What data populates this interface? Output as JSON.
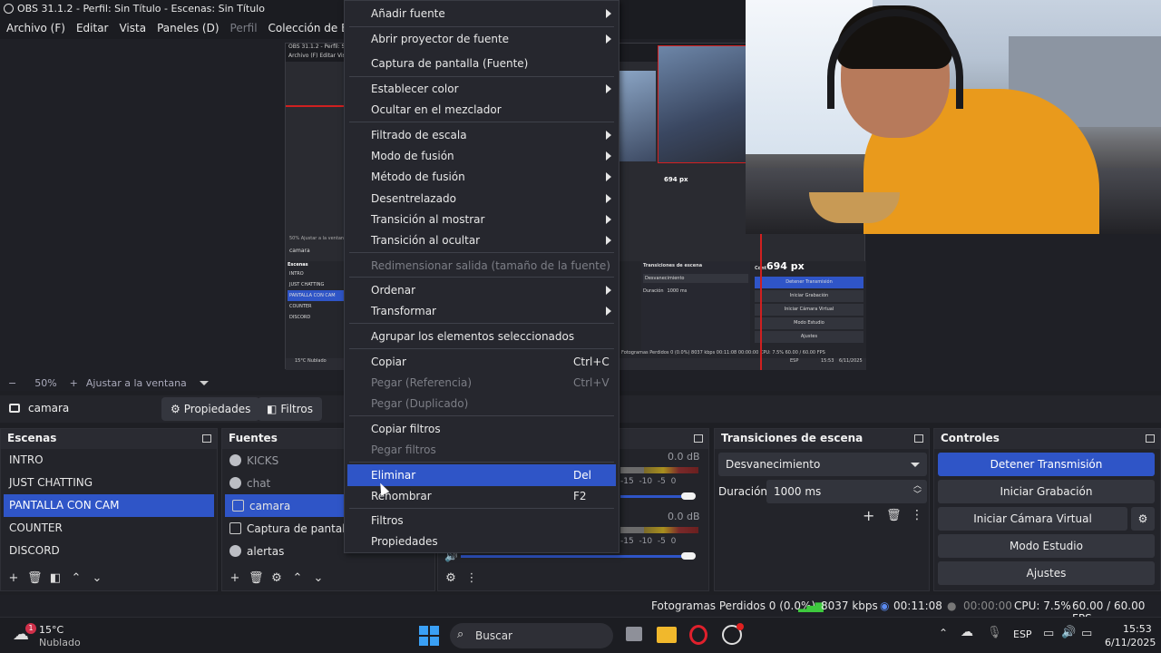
{
  "window": {
    "title": "OBS 31.1.2 - Perfil: Sin Título - Escenas: Sin Título"
  },
  "menubar": [
    "Archivo (F)",
    "Editar",
    "Vista",
    "Paneles (D)",
    "Perfil",
    "Colección de Escenas"
  ],
  "preview": {
    "nested_title": "OBS 31.1.2 - Perfil: Sin Tít",
    "nested_menu": "Archivo (F)   Editar   Vis",
    "nested_source": "camara",
    "nested_zoom": "50%   Ajustar a la ventana",
    "nested_scenes_header": "Escenas",
    "nested_scenes": [
      "INTRO",
      "JUST CHATTING",
      "PANTALLA CON CAM",
      "COUNTER",
      "DISCORD"
    ],
    "nested_trans_header": "Transiciones de escena",
    "nested_trans_value": "Desvanecimiento",
    "nested_trans_dur_label": "Duración",
    "nested_trans_dur": "1000 ms",
    "nested_controls": [
      "Detener Transmisión",
      "Iniciar Grabación",
      "Iniciar Cámara Virtual",
      "Modo Estudio",
      "Ajustes"
    ],
    "nested_status": "Fotogramas Perdidos 0 (0.0%)   8037 kbps   00:11:08   00:00:00   CPU: 7.5%   60.00 / 60.00 FPS",
    "nested_weather_temp": "15°C",
    "nested_weather_desc": "Nublado",
    "nested_lang": "ESP",
    "nested_time": "15:53",
    "nested_date": "6/11/2025",
    "px_label_top": "694 px",
    "px_label_main": "694 px",
    "nested_controls_header": "Cont"
  },
  "context_menu": {
    "items": [
      {
        "label": "Añadir fuente",
        "submenu": true
      },
      {
        "label": "Abrir proyector de fuente",
        "submenu": true
      },
      {
        "label": "Captura de pantalla (Fuente)"
      },
      {
        "label": "Establecer color",
        "submenu": true
      },
      {
        "label": "Ocultar en el mezclador"
      },
      {
        "label": "Filtrado de escala",
        "submenu": true
      },
      {
        "label": "Modo de fusión",
        "submenu": true
      },
      {
        "label": "Método de fusión",
        "submenu": true
      },
      {
        "label": "Desentrelazado",
        "submenu": true
      },
      {
        "label": "Transición al mostrar",
        "submenu": true
      },
      {
        "label": "Transición al ocultar",
        "submenu": true
      },
      {
        "label": "Redimensionar salida (tamaño de la fuente)",
        "disabled": true
      },
      {
        "label": "Ordenar",
        "submenu": true
      },
      {
        "label": "Transformar",
        "submenu": true
      },
      {
        "label": "Agrupar los elementos seleccionados"
      },
      {
        "label": "Copiar",
        "shortcut": "Ctrl+C"
      },
      {
        "label": "Pegar (Referencia)",
        "shortcut": "Ctrl+V",
        "disabled": true
      },
      {
        "label": "Pegar (Duplicado)",
        "disabled": true
      },
      {
        "label": "Copiar filtros"
      },
      {
        "label": "Pegar filtros",
        "disabled": true
      },
      {
        "label": "Eliminar",
        "shortcut": "Del",
        "highlighted": true
      },
      {
        "label": "Renombrar",
        "shortcut": "F2"
      },
      {
        "label": "Filtros"
      },
      {
        "label": "Propiedades"
      }
    ]
  },
  "zoom": {
    "minus": "−",
    "value": "50%",
    "plus": "+",
    "fit": "Ajustar a la ventana"
  },
  "source_bar": {
    "name": "camara",
    "properties": "Propiedades",
    "filters": "Filtros"
  },
  "scenes": {
    "header": "Escenas",
    "items": [
      "INTRO",
      "JUST CHATTING",
      "PANTALLA CON CAM",
      "COUNTER",
      "DISCORD"
    ],
    "selected_index": 2
  },
  "sources": {
    "header": "Fuentes",
    "items": [
      "KICKS",
      "chat",
      "camara",
      "Captura de pantalla",
      "alertas"
    ],
    "selected_index": 2
  },
  "mixer": {
    "db1": "0.0 dB",
    "db2": "0.0 dB",
    "scale": [
      "-10",
      "-15",
      "-10",
      "-5",
      "0"
    ]
  },
  "transitions": {
    "header": "Transiciones de escena",
    "value": "Desvanecimiento",
    "duration_label": "Duración",
    "duration": "1000 ms"
  },
  "controls": {
    "header": "Controles",
    "buttons": [
      "Detener Transmisión",
      "Iniciar Grabación",
      "Iniciar Cámara Virtual",
      "Modo Estudio",
      "Ajustes"
    ]
  },
  "status": {
    "dropped": "Fotogramas Perdidos 0 (0.0%)",
    "bitrate": "8037 kbps",
    "stream_time": "00:11:08",
    "rec_time": "00:00:00",
    "cpu": "CPU: 7.5%",
    "fps": "60.00 / 60.00 FPS"
  },
  "taskbar": {
    "weather_temp": "15°C",
    "weather_desc": "Nublado",
    "weather_badge": "1",
    "search": "Buscar",
    "lang": "ESP",
    "time": "15:53",
    "date": "6/11/2025"
  },
  "colors": {
    "accent": "#2f55c7",
    "panel": "#23242a",
    "live_red": "#d02020"
  }
}
